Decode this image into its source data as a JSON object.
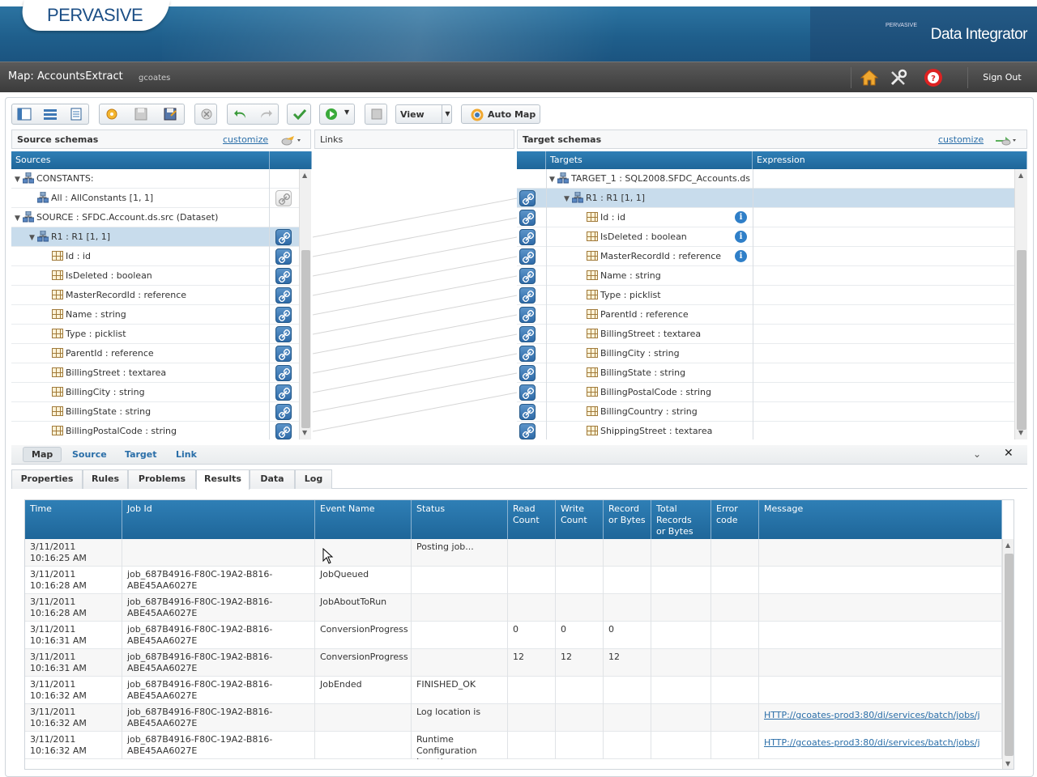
{
  "brand": {
    "logo": "PERVASIVE",
    "product_small": "PERVASIVE",
    "product": "Data Integrator"
  },
  "header": {
    "map_title": "Map: AccountsExtract",
    "user": "gcoates",
    "signout": "Sign Out"
  },
  "toolbar": {
    "view_label": "View",
    "automap_label": "Auto Map"
  },
  "source_schemas": {
    "title": "Source schemas",
    "customize": "customize",
    "column": "Sources",
    "rows": [
      {
        "label": "CONSTANTS:",
        "level": 0,
        "type": "node",
        "expanded": true,
        "link": false
      },
      {
        "label": "All : AllConstants [1, 1]",
        "level": 1,
        "type": "node",
        "link": "grey"
      },
      {
        "label": "SOURCE : SFDC.Account.ds.src (Dataset)",
        "level": 0,
        "type": "node",
        "expanded": true,
        "link": false
      },
      {
        "label": "R1 : R1 [1, 1]",
        "level": 1,
        "type": "node",
        "expanded": true,
        "link": true,
        "selected": true
      },
      {
        "label": "Id : id",
        "level": 2,
        "type": "field",
        "link": true
      },
      {
        "label": "IsDeleted : boolean",
        "level": 2,
        "type": "field",
        "link": true
      },
      {
        "label": "MasterRecordId : reference",
        "level": 2,
        "type": "field",
        "link": true
      },
      {
        "label": "Name : string",
        "level": 2,
        "type": "field",
        "link": true
      },
      {
        "label": "Type : picklist",
        "level": 2,
        "type": "field",
        "link": true
      },
      {
        "label": "ParentId : reference",
        "level": 2,
        "type": "field",
        "link": true
      },
      {
        "label": "BillingStreet : textarea",
        "level": 2,
        "type": "field",
        "link": true
      },
      {
        "label": "BillingCity : string",
        "level": 2,
        "type": "field",
        "link": true
      },
      {
        "label": "BillingState : string",
        "level": 2,
        "type": "field",
        "link": true
      },
      {
        "label": "BillingPostalCode : string",
        "level": 2,
        "type": "field",
        "link": true
      }
    ]
  },
  "links": {
    "title": "Links"
  },
  "target_schemas": {
    "title": "Target schemas",
    "customize": "customize",
    "column": "Targets",
    "expression_column": "Expression",
    "rows": [
      {
        "label": "TARGET_1 : SQL2008.SFDC_Accounts.ds",
        "level": 0,
        "type": "node",
        "expanded": true,
        "link": false
      },
      {
        "label": "R1 : R1 [1, 1]",
        "level": 1,
        "type": "node",
        "expanded": true,
        "link": true,
        "selected": true
      },
      {
        "label": "Id : id",
        "level": 2,
        "type": "field",
        "link": true,
        "info": true
      },
      {
        "label": "IsDeleted : boolean",
        "level": 2,
        "type": "field",
        "link": true,
        "info": true
      },
      {
        "label": "MasterRecordId : reference",
        "level": 2,
        "type": "field",
        "link": true,
        "info": true
      },
      {
        "label": "Name : string",
        "level": 2,
        "type": "field",
        "link": true
      },
      {
        "label": "Type : picklist",
        "level": 2,
        "type": "field",
        "link": true
      },
      {
        "label": "ParentId : reference",
        "level": 2,
        "type": "field",
        "link": true
      },
      {
        "label": "BillingStreet : textarea",
        "level": 2,
        "type": "field",
        "link": true
      },
      {
        "label": "BillingCity : string",
        "level": 2,
        "type": "field",
        "link": true
      },
      {
        "label": "BillingState : string",
        "level": 2,
        "type": "field",
        "link": true
      },
      {
        "label": "BillingPostalCode : string",
        "level": 2,
        "type": "field",
        "link": true
      },
      {
        "label": "BillingCountry : string",
        "level": 2,
        "type": "field",
        "link": true
      },
      {
        "label": "ShippingStreet : textarea",
        "level": 2,
        "type": "field",
        "link": true
      }
    ]
  },
  "subtabs": [
    "Map",
    "Source",
    "Target",
    "Link"
  ],
  "tabs": [
    "Properties",
    "Rules",
    "Problems",
    "Results",
    "Data",
    "Log"
  ],
  "active_tab": "Results",
  "results": {
    "columns": [
      "Time",
      "Job Id",
      "Event Name",
      "Status",
      "Read\nCount",
      "Write\nCount",
      "Record\nor Bytes",
      "Total\nRecords\nor Bytes",
      "Error\ncode",
      "Message"
    ],
    "rows": [
      [
        "3/11/2011\n10:16:25 AM",
        "",
        "",
        "Posting job...",
        "",
        "",
        "",
        "",
        "",
        ""
      ],
      [
        "3/11/2011\n10:16:28 AM",
        "job_687B4916-F80C-19A2-B816-\nABE45AA6027E",
        "JobQueued",
        "",
        "",
        "",
        "",
        "",
        "",
        ""
      ],
      [
        "3/11/2011\n10:16:28 AM",
        "job_687B4916-F80C-19A2-B816-\nABE45AA6027E",
        "JobAboutToRun",
        "",
        "",
        "",
        "",
        "",
        "",
        ""
      ],
      [
        "3/11/2011\n10:16:31 AM",
        "job_687B4916-F80C-19A2-B816-\nABE45AA6027E",
        "ConversionProgress",
        "",
        "0",
        "0",
        "0",
        "",
        "",
        ""
      ],
      [
        "3/11/2011\n10:16:31 AM",
        "job_687B4916-F80C-19A2-B816-\nABE45AA6027E",
        "ConversionProgress",
        "",
        "12",
        "12",
        "12",
        "",
        "",
        ""
      ],
      [
        "3/11/2011\n10:16:32 AM",
        "job_687B4916-F80C-19A2-B816-\nABE45AA6027E",
        "JobEnded",
        "FINISHED_OK",
        "",
        "",
        "",
        "",
        "",
        ""
      ],
      [
        "3/11/2011\n10:16:32 AM",
        "job_687B4916-F80C-19A2-B816-\nABE45AA6027E",
        "",
        "Log location is",
        "",
        "",
        "",
        "",
        "",
        "HTTP://gcoates-prod3:80/di/services/batch/jobs/j"
      ],
      [
        "3/11/2011\n10:16:32 AM",
        "job_687B4916-F80C-19A2-B816-\nABE45AA6027E",
        "",
        "Runtime\nConfiguration\nLocation",
        "",
        "",
        "",
        "",
        "",
        "HTTP://gcoates-prod3:80/di/services/batch/jobs/j"
      ]
    ]
  },
  "colors": {
    "accent": "#1e6699",
    "link": "#2a6ea8",
    "selected": "#c8dcec"
  }
}
